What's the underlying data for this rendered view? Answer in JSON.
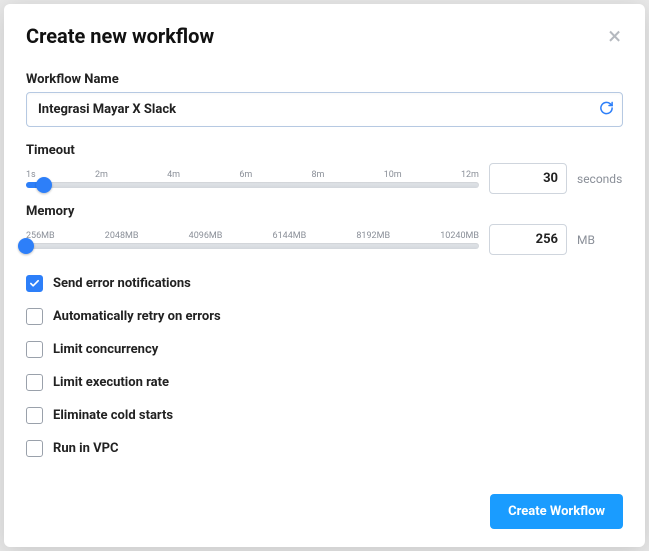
{
  "modal": {
    "title": "Create new workflow",
    "name_label": "Workflow Name",
    "name_value": "Integrasi Mayar X Slack",
    "timeout": {
      "label": "Timeout",
      "ticks": [
        "1s",
        "2m",
        "4m",
        "6m",
        "8m",
        "10m",
        "12m"
      ],
      "value": "30",
      "unit": "seconds",
      "fill_pct": 4
    },
    "memory": {
      "label": "Memory",
      "ticks": [
        "256MB",
        "2048MB",
        "4096MB",
        "6144MB",
        "8192MB",
        "10240MB"
      ],
      "value": "256",
      "unit": "MB",
      "fill_pct": 0
    },
    "options": [
      {
        "label": "Send error notifications",
        "checked": true
      },
      {
        "label": "Automatically retry on errors",
        "checked": false
      },
      {
        "label": "Limit concurrency",
        "checked": false
      },
      {
        "label": "Limit execution rate",
        "checked": false
      },
      {
        "label": "Eliminate cold starts",
        "checked": false
      },
      {
        "label": "Run in VPC",
        "checked": false
      }
    ],
    "submit_label": "Create Workflow"
  }
}
